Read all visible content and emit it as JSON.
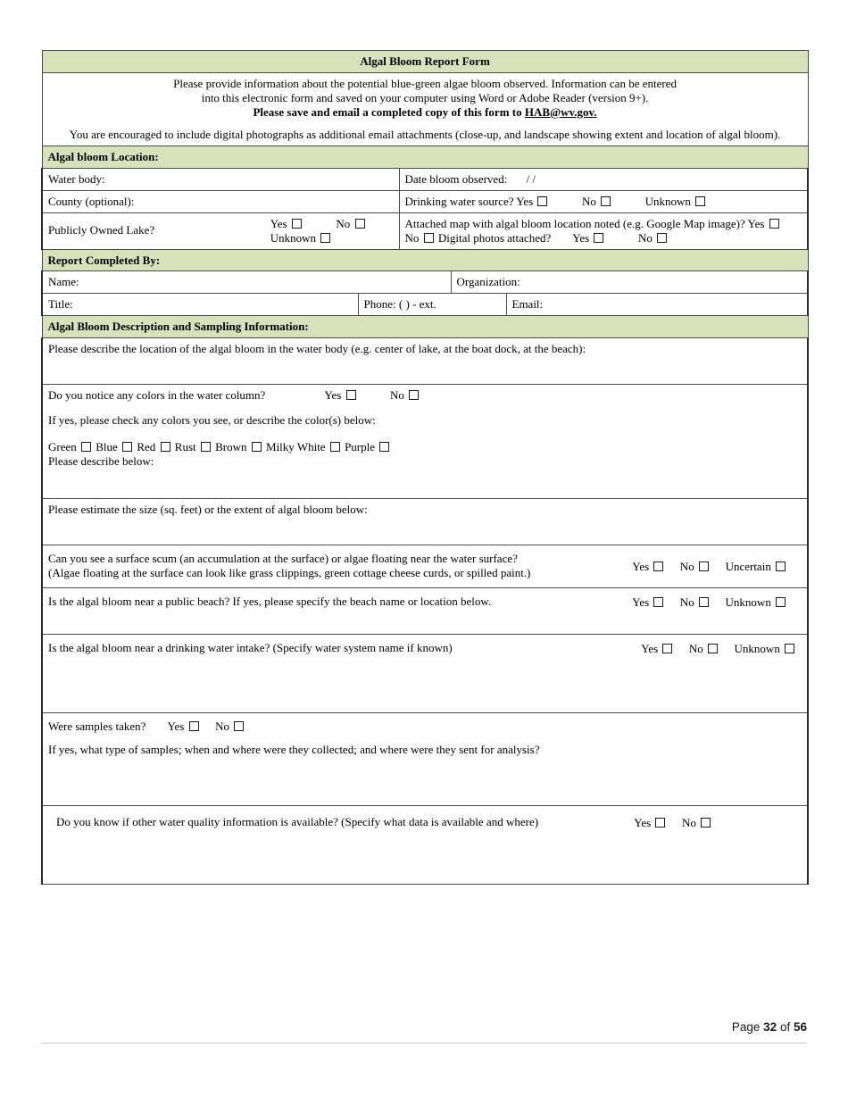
{
  "form": {
    "title": "Algal Bloom Report Form",
    "intro_line1": "Please provide information about the potential blue-green algae bloom observed. Information can be entered",
    "intro_line2": "into this electronic form and saved on your computer using Word or Adobe Reader (version 9+).",
    "intro_bold_prefix": "Please save and email a completed copy of this form to ",
    "intro_email": "HAB@wv.gov.",
    "intro_photos": "You are encouraged to include digital photographs as additional email attachments (close-up, and landscape showing extent and location of algal bloom)."
  },
  "section_location": {
    "heading": "Algal bloom Location:",
    "water_body_label": "Water body:",
    "date_label": "Date bloom observed:",
    "date_slashes": "/     /",
    "county_label": "County (optional):",
    "drinking_label": "Drinking water source?",
    "drinking_yes": "Yes",
    "drinking_no": "No",
    "drinking_unknown": "Unknown",
    "lake_label": "Publicly Owned Lake?",
    "lake_yes": "Yes",
    "lake_no": "No",
    "lake_unknown": "Unknown",
    "map_label": "Attached map with algal bloom location noted (e.g. Google Map image)?",
    "map_yes": "Yes",
    "map_no": "No",
    "photos_label": "Digital photos attached?",
    "photos_yes": "Yes",
    "photos_no": "No"
  },
  "section_reporter": {
    "heading": "Report Completed By:",
    "name_label": "Name:",
    "organization_label": "Organization:",
    "title_label": "Title:",
    "phone_label": "Phone: (          )          -          ext.",
    "email_label": "Email:"
  },
  "section_description": {
    "heading": "Algal Bloom Description and Sampling Information:",
    "q_location": "Please describe the location of the algal bloom in the water body (e.g. center of lake, at the boat dock, at the beach):",
    "q_colors": "Do you notice any colors in the water column?",
    "q_colors_yes": "Yes",
    "q_colors_no": "No",
    "q_colors_hint": "If yes, please check any colors you see, or describe the color(s) below:",
    "colors": [
      "Green",
      "Blue",
      "Red",
      "Rust",
      "Brown",
      "Milky White",
      "Purple"
    ],
    "describe_below": "Please describe below:",
    "q_size": "Please estimate the size (sq. feet) or the extent of algal bloom below:",
    "q_scum_line1": "Can you see a surface scum (an accumulation at the surface) or algae floating near the water surface?",
    "q_scum_line2": "(Algae floating at the surface can look like grass clippings, green cottage cheese curds, or spilled paint.)",
    "q_scum_yes": "Yes",
    "q_scum_no": "No",
    "q_scum_uncertain": "Uncertain",
    "q_beach": "Is the algal bloom near a public beach? If yes, please specify the beach name or location below.",
    "q_beach_yes": "Yes",
    "q_beach_no": "No",
    "q_beach_unknown": "Unknown",
    "q_intake": "Is the algal bloom near a drinking water intake? (Specify water system name if known)",
    "q_intake_yes": "Yes",
    "q_intake_no": "No",
    "q_intake_unknown": "Unknown",
    "q_samples": "Were samples taken?",
    "q_samples_yes": "Yes",
    "q_samples_no": "No",
    "q_samples_detail": "If yes, what type of samples; when and where were they collected; and where were they sent for analysis?",
    "q_wq": "Do you know if other water quality information is available? (Specify what data is available and where)",
    "q_wq_yes": "Yes",
    "q_wq_no": "No"
  },
  "footer": {
    "page_word": "Page",
    "page_number": "32",
    "of_word": "of",
    "total_pages": "56"
  },
  "colors": {
    "section_green": "#d7e2bb",
    "border_dark": "#2b2b2b",
    "border_grey": "#4a4a4a"
  }
}
